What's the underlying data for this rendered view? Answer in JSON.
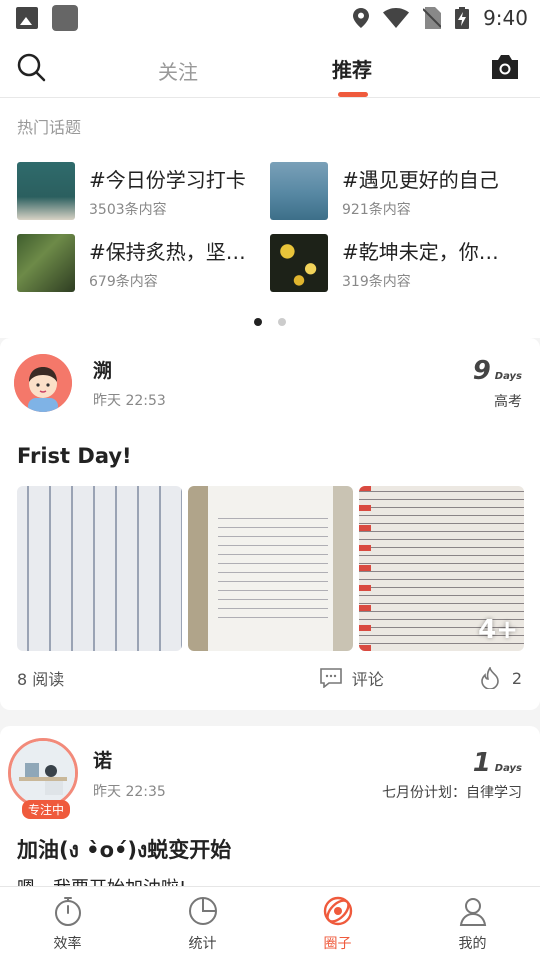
{
  "status_bar": {
    "time": "9:40"
  },
  "header": {
    "tabs": [
      {
        "label": "关注",
        "active": false
      },
      {
        "label": "推荐",
        "active": true
      }
    ]
  },
  "hot_topics": {
    "title": "热门话题",
    "items": [
      {
        "name": "#今日份学习打卡",
        "count": "3503条内容"
      },
      {
        "name": "#遇见更好的自己",
        "count": "921条内容"
      },
      {
        "name": "#保持炙热，坚持…",
        "count": "679条内容"
      },
      {
        "name": "#乾坤未定，你我…",
        "count": "319条内容"
      }
    ],
    "page_indicator": {
      "total": 2,
      "current": 1
    }
  },
  "posts": [
    {
      "author": "溯",
      "time": "昨天 22:53",
      "days_num": "9",
      "days_unit": "Days",
      "tag": "高考",
      "title": "Frist Day!",
      "more_photos": "4+",
      "reads": "8 阅读",
      "comment_label": "评论",
      "likes": "2"
    },
    {
      "author": "诺",
      "time": "昨天 22:35",
      "days_num": "1",
      "days_unit": "Days",
      "tag": "七月份计划：自律学习",
      "badge": "专注中",
      "title": "加油(ง •̀o•́)ง蜕变开始",
      "body": "嗯，我要开始加油啦!"
    }
  ],
  "bottom_nav": [
    {
      "label": "效率",
      "icon": "stopwatch-icon",
      "active": false
    },
    {
      "label": "统计",
      "icon": "pie-chart-icon",
      "active": false
    },
    {
      "label": "圈子",
      "icon": "planet-icon",
      "active": true
    },
    {
      "label": "我的",
      "icon": "person-icon",
      "active": false
    }
  ],
  "colors": {
    "accent": "#ef5a3c"
  }
}
